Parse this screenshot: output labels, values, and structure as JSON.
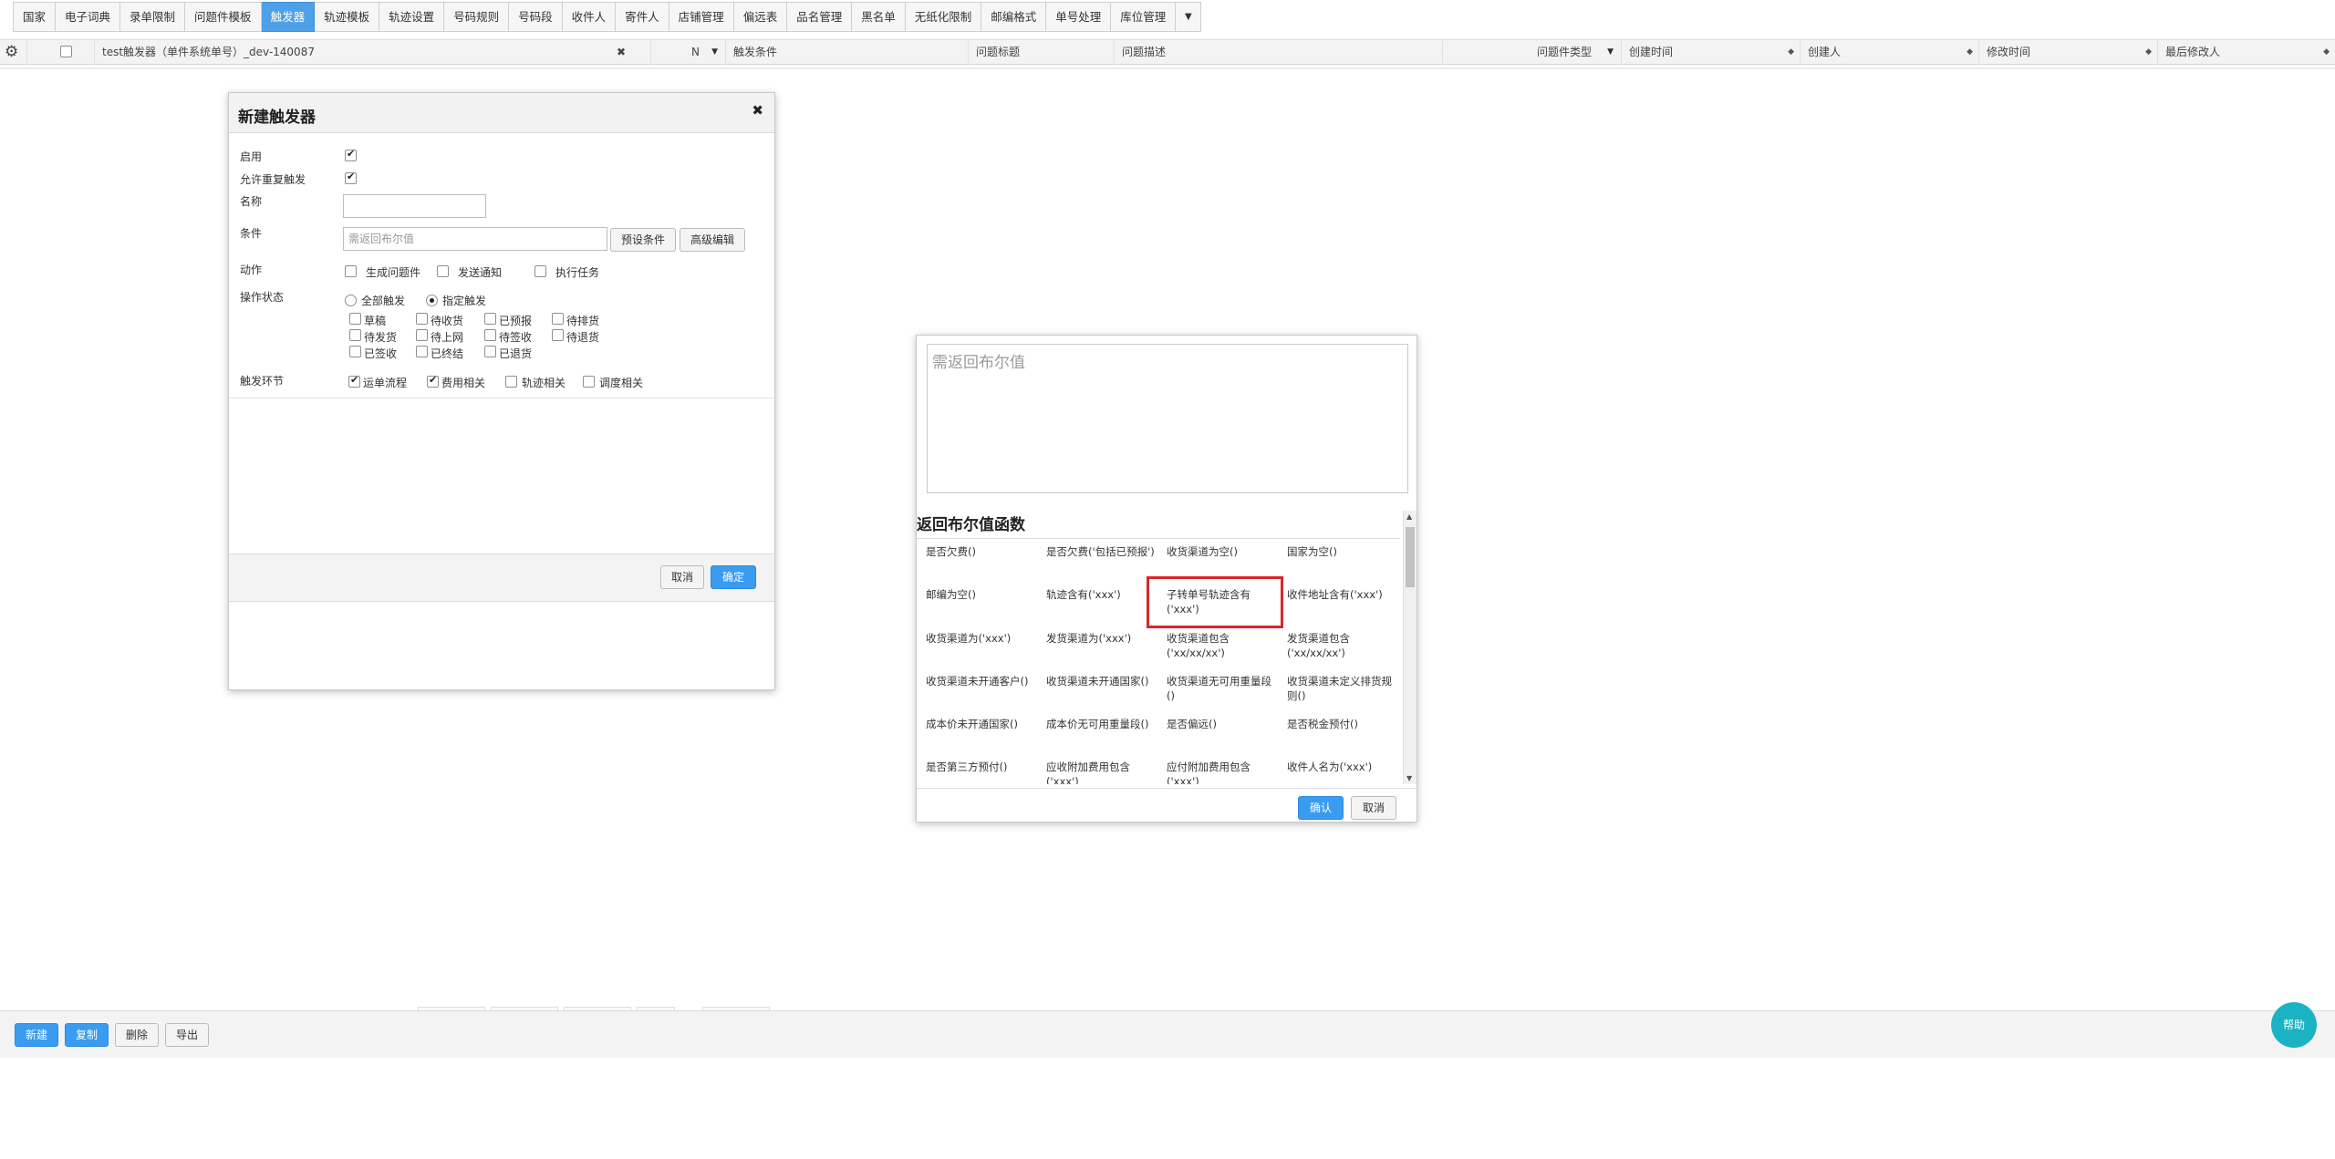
{
  "tabs": [
    "国家",
    "电子词典",
    "录单限制",
    "问题件模板",
    "触发器",
    "轨迹模板",
    "轨迹设置",
    "号码规则",
    "号码段",
    "收件人",
    "寄件人",
    "店铺管理",
    "偏远表",
    "品名管理",
    "黑名单",
    "无纸化限制",
    "邮编格式",
    "单号处理",
    "库位管理"
  ],
  "tabs_active": "触发器",
  "grid": {
    "trigger_name": "test触发器（单件系统单号）_dev-140087",
    "n_col": "N",
    "columns": {
      "cond": "触发条件",
      "title": "问题标题",
      "desc": "问题描述",
      "type": "问题件类型",
      "created": "创建时间",
      "creator": "创建人",
      "modified": "修改时间",
      "modifier": "最后修改人"
    }
  },
  "dialog1": {
    "title": "新建触发器",
    "close": "✖",
    "enable_label": "启用",
    "repeat_label": "允许重复触发",
    "name_label": "名称",
    "cond_label": "条件",
    "cond_placeholder": "需返回布尔值",
    "preset_btn": "预设条件",
    "advanced_btn": "高级编辑",
    "action_label": "动作",
    "actions": [
      "生成问题件",
      "发送通知",
      "执行任务"
    ],
    "opstate_label": "操作状态",
    "all_trigger": "全部触发",
    "specified_trigger": "指定触发",
    "states": [
      "草稿",
      "待收货",
      "已预报",
      "待排货",
      "待发货",
      "待上网",
      "待签收",
      "待退货",
      "已签收",
      "已终结",
      "已退货"
    ],
    "stage_label": "触发环节",
    "stages": [
      "运单流程",
      "费用相关",
      "轨迹相关",
      "调度相关"
    ],
    "cancel": "取消",
    "ok": "确定"
  },
  "dialog2": {
    "textarea_placeholder": "需返回布尔值",
    "functions_title": "返回布尔值函数",
    "functions": [
      "是否欠费()",
      "是否欠费('包括已预报')",
      "收货渠道为空()",
      "国家为空()",
      "邮编为空()",
      "轨迹含有('xxx')",
      "子转单号轨迹含有('xxx')",
      "收件地址含有('xxx')",
      "收货渠道为('xxx')",
      "发货渠道为('xxx')",
      "收货渠道包含('xx/xx/xx')",
      "发货渠道包含('xx/xx/xx')",
      "收货渠道未开通客户()",
      "收货渠道未开通国家()",
      "收货渠道无可用重量段()",
      "收货渠道未定义排货规则()",
      "成本价未开通国家()",
      "成本价无可用重量段()",
      "是否偏远()",
      "是否税金预付()",
      "是否第三方预付()",
      "应收附加费用包含('xxx')",
      "应付附加费用包含('xxx')",
      "收件人名为('xxx')"
    ],
    "confirm": "确认",
    "cancel": "取消"
  },
  "bottom": {
    "new": "新建",
    "copy": "复制",
    "delete": "删除",
    "export": "导出"
  },
  "help": "帮助"
}
